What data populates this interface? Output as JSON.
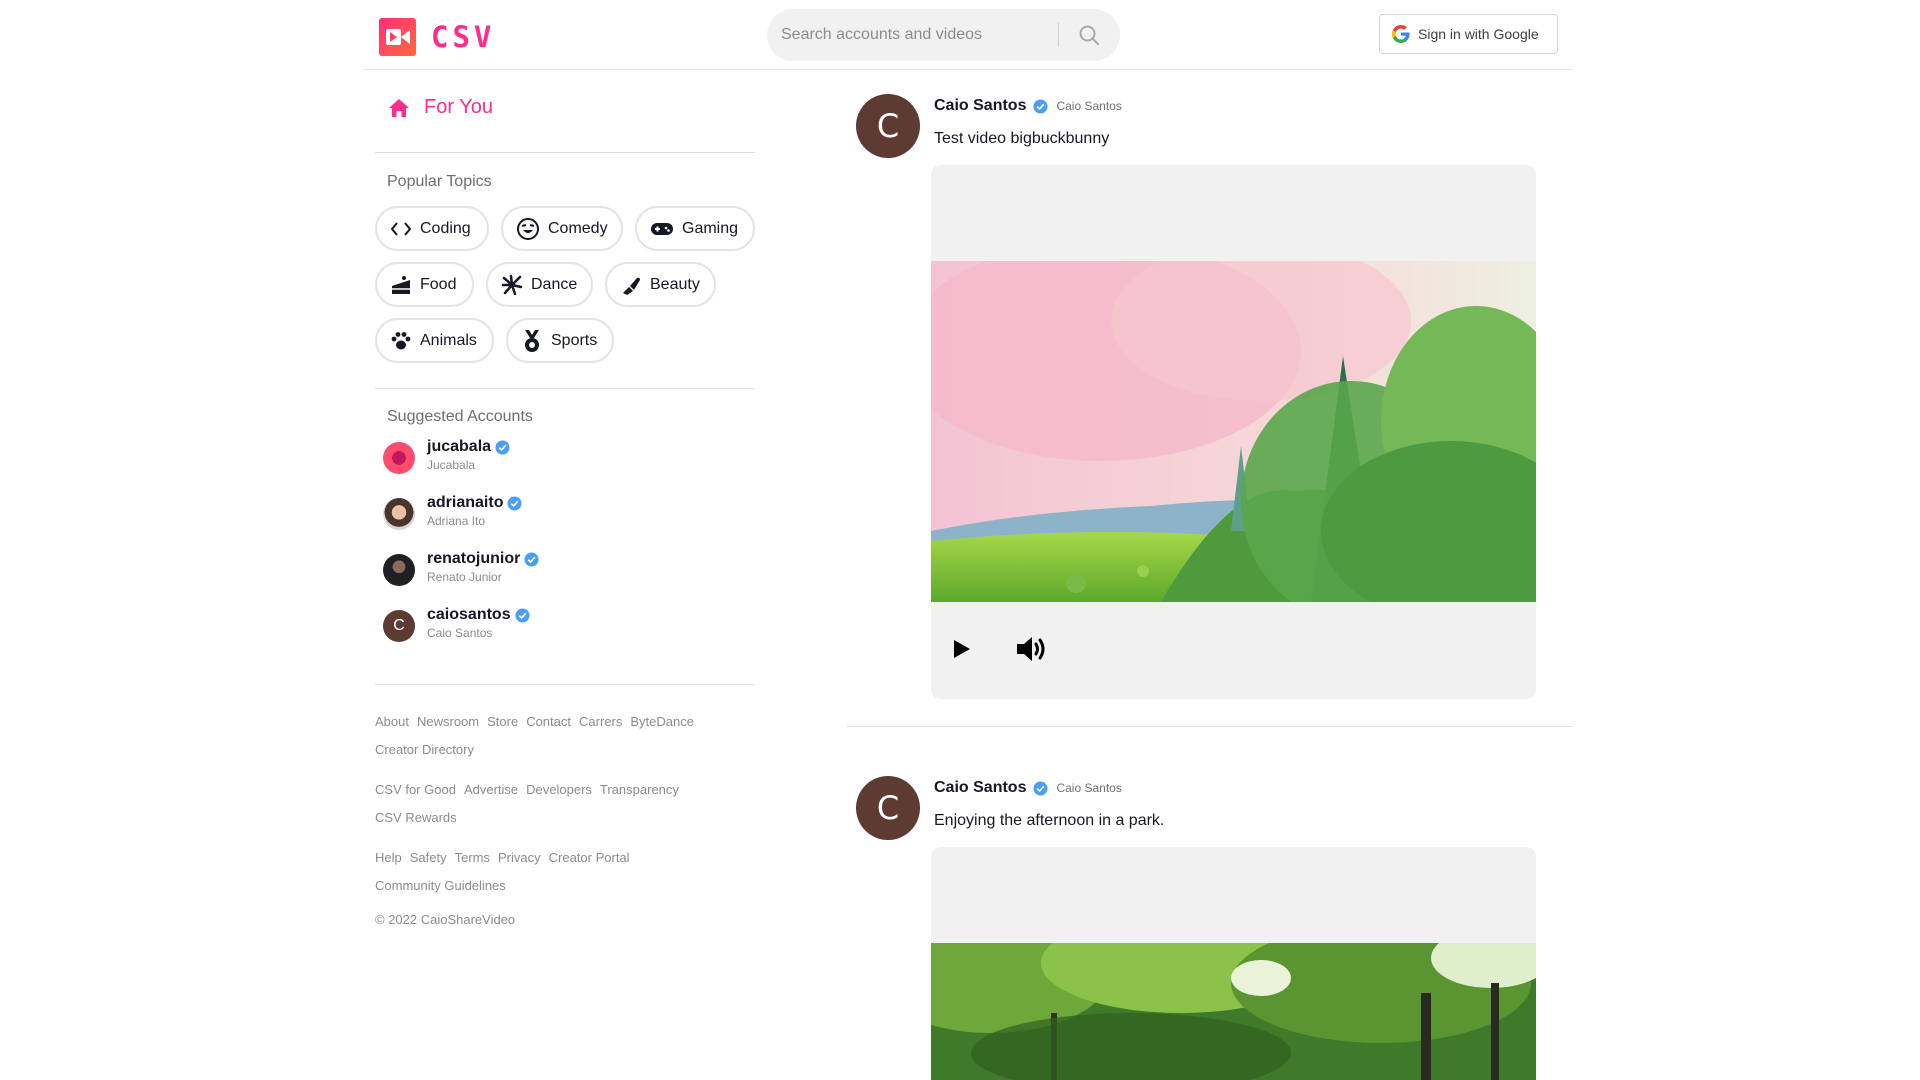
{
  "header": {
    "logo_text": "CSV",
    "search_placeholder": "Search accounts and videos",
    "signin_label": "Sign in with Google"
  },
  "sidebar": {
    "for_you_label": "For You",
    "popular_topics_title": "Popular Topics",
    "topics": [
      {
        "label": "Coding",
        "icon": "code-icon"
      },
      {
        "label": "Comedy",
        "icon": "laughing-face-icon"
      },
      {
        "label": "Gaming",
        "icon": "gamepad-icon"
      },
      {
        "label": "Food",
        "icon": "cake-icon"
      },
      {
        "label": "Dance",
        "icon": "dance-icon"
      },
      {
        "label": "Beauty",
        "icon": "lipstick-icon"
      },
      {
        "label": "Animals",
        "icon": "paw-icon"
      },
      {
        "label": "Sports",
        "icon": "medal-icon"
      }
    ],
    "suggested_accounts_title": "Suggested Accounts",
    "accounts": [
      {
        "username": "jucabala",
        "name": "Jucabala"
      },
      {
        "username": "adrianaito",
        "name": "Adriana Ito"
      },
      {
        "username": "renatojunior",
        "name": "Renato Junior"
      },
      {
        "username": "caiosantos",
        "name": "Caio Santos",
        "initial": "C"
      }
    ],
    "footer": {
      "group1": [
        "About",
        "Newsroom",
        "Store",
        "Contact",
        "Carrers",
        "ByteDance",
        "Creator Directory"
      ],
      "group2": [
        "CSV for Good",
        "Advertise",
        "Developers",
        "Transparency",
        "CSV Rewards"
      ],
      "group3": [
        "Help",
        "Safety",
        "Terms",
        "Privacy",
        "Creator Portal",
        "Community Guidelines"
      ],
      "copyright": "© 2022 CaioShareVideo"
    }
  },
  "feed": {
    "posts": [
      {
        "initial": "C",
        "user": "Caio Santos",
        "nick": "Caio Santos",
        "caption": "Test video bigbuckbunny"
      },
      {
        "initial": "C",
        "user": "Caio Santos",
        "nick": "Caio Santos",
        "caption": "Enjoying the afternoon in a park."
      }
    ]
  },
  "colors": {
    "brand": "#fe2c8a",
    "verified": "#20d5ec",
    "avatar_bg": "#5d3b33"
  }
}
